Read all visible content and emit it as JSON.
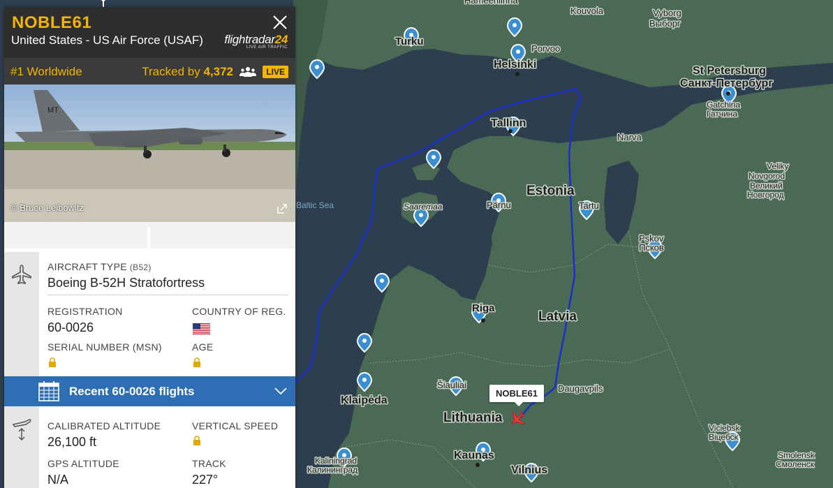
{
  "flight": {
    "callsign": "NOBLE61",
    "operator": "United States - US Air Force (USAF)",
    "map_tag": "NOBLE61"
  },
  "logo": {
    "name_part1": "flightradar",
    "name_part2": "24",
    "tagline": "LIVE AIR TRAFFIC"
  },
  "status": {
    "rank": "#1 Worldwide",
    "tracked_prefix": "Tracked by",
    "tracked_count": "4,372",
    "live_badge": "LIVE"
  },
  "photo": {
    "credit": "© Bruce Leibowitz",
    "tail_marking": "MT"
  },
  "aircraft": {
    "type_label": "AIRCRAFT TYPE",
    "type_code": "(B52)",
    "type_value": "Boeing B-52H Stratofortress",
    "registration_label": "REGISTRATION",
    "registration_value": "60-0026",
    "country_label": "COUNTRY OF REG.",
    "serial_label": "SERIAL NUMBER (MSN)",
    "age_label": "AGE"
  },
  "recent_flights": {
    "label": "Recent 60-0026 flights"
  },
  "flight_data": {
    "calibrated_altitude_label": "CALIBRATED ALTITUDE",
    "calibrated_altitude_value": "26,100 ft",
    "vertical_speed_label": "VERTICAL SPEED",
    "gps_altitude_label": "GPS ALTITUDE",
    "gps_altitude_value": "N/A",
    "track_label": "TRACK",
    "track_value": "227°"
  },
  "map": {
    "labels": {
      "hameenlinna": "Hämeenlinna",
      "kouvola": "Kouvola",
      "vyborg": "Vyborg",
      "vyborg_ru": "Выборг",
      "turku": "Turku",
      "porvoo": "Porvoo",
      "helsinki": "Helsinki",
      "st_petersburg": "St Petersburg",
      "st_petersburg_ru": "Санкт-Петербург",
      "gatchina": "Gatchina",
      "gatchina_ru": "Гатчина",
      "tallinn": "Tallinn",
      "narva": "Narva",
      "veliky": "Veliky",
      "novgorod": "Novgorod",
      "veliky_ru": "Великий",
      "novgorod_ru": "Новгород",
      "estonia": "Estonia",
      "saaremaa": "Saaremaa",
      "parnu": "Pärnu",
      "tartu": "Tartu",
      "baltic_sea": "Baltic Sea",
      "pskov": "Pskov",
      "pskov_ru": "Псков",
      "riga": "Riga",
      "latvia": "Latvia",
      "siauliai": "Šiauliai",
      "daugavpils": "Daugavpils",
      "klaipeda": "Klaipėda",
      "lithuania": "Lithuania",
      "viciebsk": "Viciebsk",
      "viciebsk_by": "Віцебск",
      "kaunas": "Kaunas",
      "kaliningrad": "Kaliningrad",
      "kaliningrad_ru": "Калининград",
      "vilnius": "Vilnius",
      "smolensk": "Smolensk",
      "smolensk_ru": "Смоленск"
    }
  },
  "colors": {
    "brand_accent": "#f5b400",
    "flight_path": "#1b2ec8",
    "recent_bar": "#2e6eb5",
    "aircraft_marker": "#e03a3a",
    "pin": "#3a8fd0"
  }
}
